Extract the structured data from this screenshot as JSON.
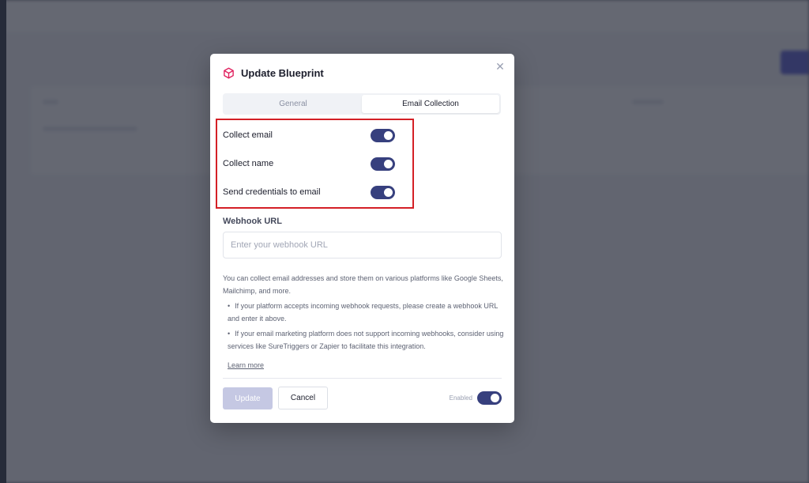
{
  "modal": {
    "title": "Update Blueprint",
    "close_icon": "close-icon",
    "header_icon": "cube-icon",
    "accent_icon_color": "#e0225f"
  },
  "tabs": [
    {
      "label": "General",
      "active": false
    },
    {
      "label": "Email Collection",
      "active": true
    }
  ],
  "toggles": [
    {
      "label": "Collect email",
      "on": true
    },
    {
      "label": "Collect name",
      "on": true
    },
    {
      "label": "Send credentials to email",
      "on": true
    }
  ],
  "webhook": {
    "label": "Webhook URL",
    "placeholder": "Enter your webhook URL",
    "value": ""
  },
  "help": {
    "intro": "You can collect email addresses and store them on various platforms like Google Sheets, Mailchimp, and more.",
    "bullets": [
      "If your platform accepts incoming webhook requests, please create a webhook URL and enter it above.",
      "If your email marketing platform does not support incoming webhooks, consider using services like SureTriggers or Zapier to facilitate this integration."
    ],
    "learn_more": "Learn more"
  },
  "footer": {
    "update_label": "Update",
    "cancel_label": "Cancel",
    "enabled_label": "Enabled",
    "enabled_on": true
  },
  "colors": {
    "toggle_on": "#37407e",
    "highlight_border": "#d42026",
    "update_disabled": "#c5c8e3"
  }
}
